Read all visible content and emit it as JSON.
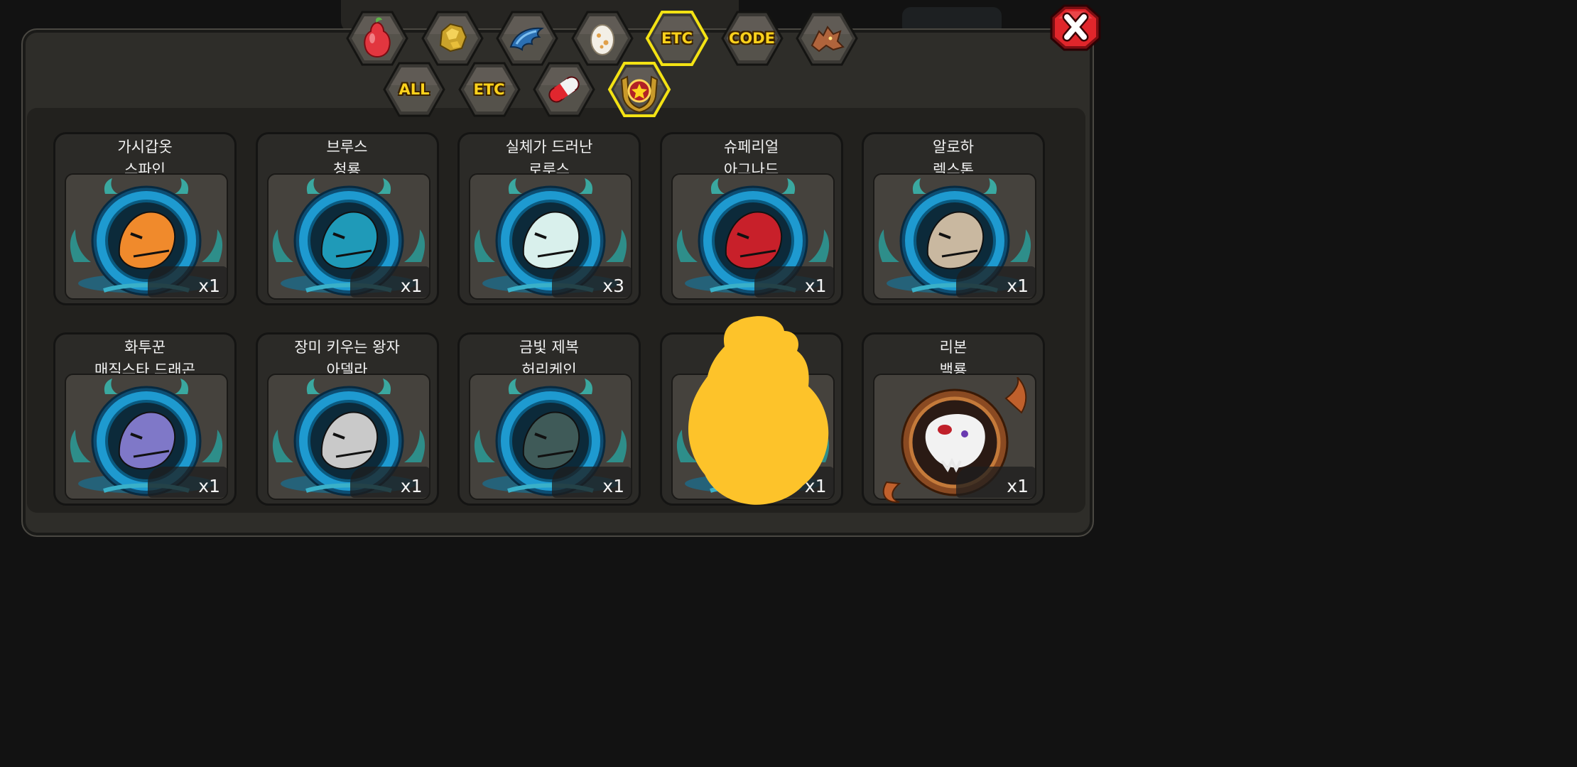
{
  "tabs_row1": [
    {
      "name": "fruit-tab",
      "icon": "pear-icon",
      "label": ""
    },
    {
      "name": "gold-tab",
      "icon": "gold-ore-icon",
      "label": ""
    },
    {
      "name": "scale-tab",
      "icon": "blue-scale-icon",
      "label": ""
    },
    {
      "name": "egg-tab",
      "icon": "egg-icon",
      "label": ""
    },
    {
      "name": "etc-tab-top",
      "icon": "",
      "label": "ETC",
      "selected": true
    },
    {
      "name": "code-tab",
      "icon": "",
      "label": "CODE"
    },
    {
      "name": "dragon-tab",
      "icon": "dragon-head-icon",
      "label": ""
    }
  ],
  "tabs_row2": [
    {
      "name": "all-tab",
      "icon": "",
      "label": "ALL"
    },
    {
      "name": "etc-tab-sub",
      "icon": "",
      "label": "ETC"
    },
    {
      "name": "capsule-tab",
      "icon": "capsule-icon",
      "label": ""
    },
    {
      "name": "badge-tab",
      "icon": "star-badge-icon",
      "label": "",
      "selected": true
    }
  ],
  "items": [
    {
      "name": "가시갑옷\n스파인",
      "count": "x1",
      "color": "#f08a2c",
      "frame": "blue"
    },
    {
      "name": "브루스\n청룡",
      "count": "x1",
      "color": "#1f9ab8",
      "frame": "blue"
    },
    {
      "name": "실체가 드러난\n로루스",
      "count": "x3",
      "color": "#d9f0ec",
      "frame": "blue"
    },
    {
      "name": "슈페리얼\n아그나드",
      "count": "x1",
      "color": "#c8202a",
      "frame": "blue"
    },
    {
      "name": "알로하\n렉스톤",
      "count": "x1",
      "color": "#c9b8a0",
      "frame": "blue"
    },
    {
      "name": "화투꾼\n매직스타 드래곤",
      "count": "x1",
      "color": "#7f78c8",
      "frame": "blue"
    },
    {
      "name": "장미 키우는 왕자\n아델라",
      "count": "x1",
      "color": "#c9c9c9",
      "frame": "blue"
    },
    {
      "name": "금빛 제복\n허리케인",
      "count": "x1",
      "color": "#3f5a58",
      "frame": "blue"
    },
    {
      "name": "",
      "count": "x1",
      "color": "#2aa0b8",
      "frame": "blue"
    },
    {
      "name": "리본\n백룡",
      "count": "x1",
      "color": "#f2f2f2",
      "frame": "bronze"
    }
  ],
  "close_icon": "close-x-icon",
  "colors": {
    "accent": "#ffd21c",
    "selected_border": "#f3e214",
    "close_red": "#e0262b",
    "censor": "#fdc32a"
  }
}
